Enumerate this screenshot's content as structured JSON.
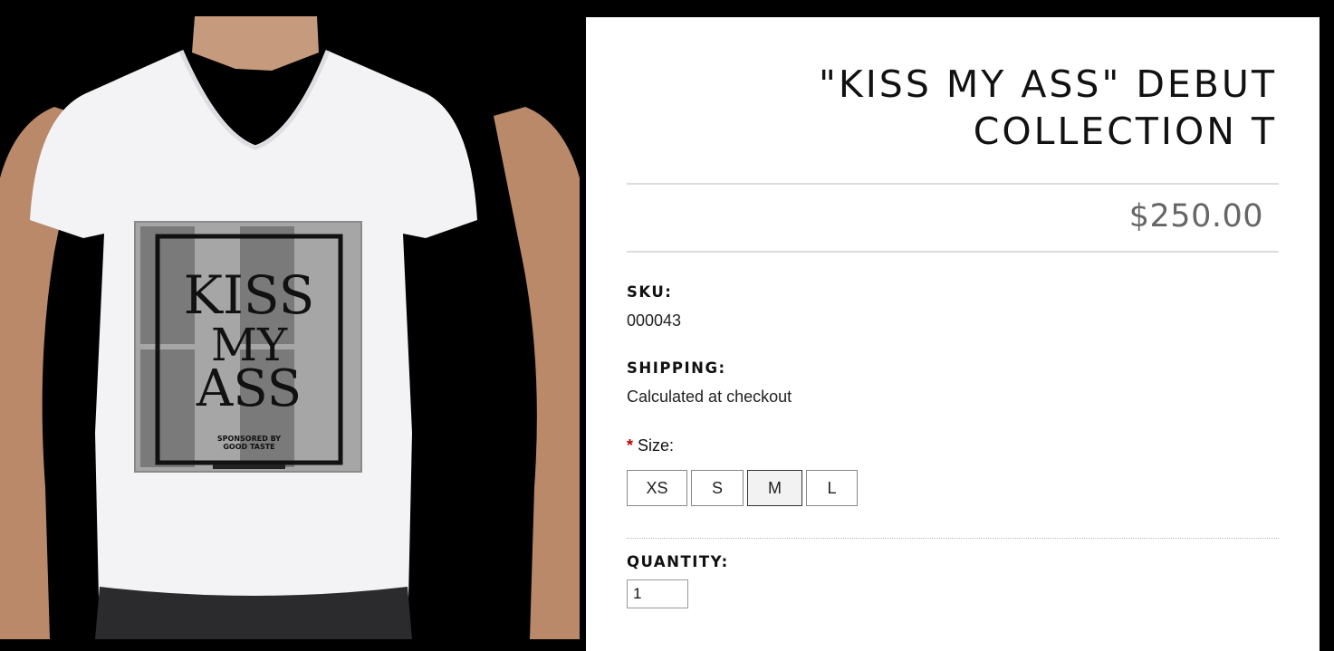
{
  "product": {
    "title_line1": "\"KISS MY ASS\" DEBUT",
    "title_line2": "COLLECTION T",
    "price": "$250.00",
    "image": {
      "print_text": [
        "KISS",
        "MY",
        "ASS"
      ],
      "print_small": [
        "SPONSORED BY",
        "GOOD TASTE"
      ]
    }
  },
  "details": {
    "sku_label": "SKU:",
    "sku_value": "000043",
    "shipping_label": "SHIPPING:",
    "shipping_value": "Calculated at checkout",
    "size_required_marker": "*",
    "size_label": "Size:",
    "sizes": [
      {
        "label": "XS",
        "selected": false
      },
      {
        "label": "S",
        "selected": false
      },
      {
        "label": "M",
        "selected": true
      },
      {
        "label": "L",
        "selected": false
      }
    ],
    "quantity_label": "QUANTITY:",
    "quantity_value": "1"
  },
  "colors": {
    "background": "#000000",
    "panel": "#ffffff",
    "price": "#666666",
    "required": "#bb0000"
  }
}
